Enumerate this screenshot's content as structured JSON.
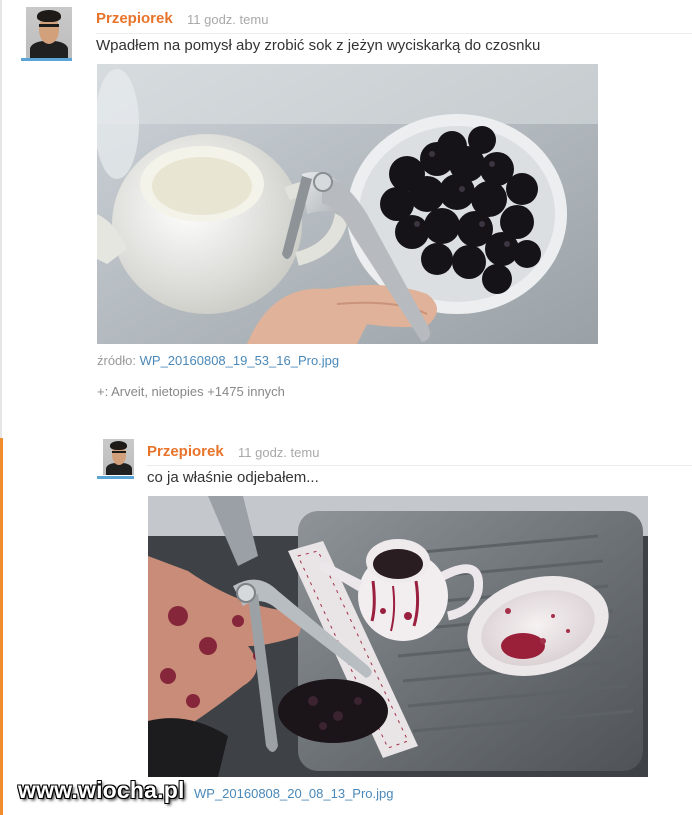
{
  "posts": [
    {
      "author": "Przepiorek",
      "time": "11 godz. temu",
      "text": "Wpadłem na pomysł aby zrobić sok z jeżyn wyciskarką do czosnku",
      "source_label": "źródło: ",
      "source_file": "WP_20160808_19_53_16_Pro.jpg",
      "plus_line": "+: Arveit, nietopies +1475 innych"
    },
    {
      "author": "Przepiorek",
      "time": "11 godz. temu",
      "text": "co ja właśnie odjebałem...",
      "source_file": "WP_20160808_20_08_13_Pro.jpg"
    }
  ],
  "watermark": "www.wiocha.pl",
  "colors": {
    "author": "#e8742b",
    "link": "#4a88b8",
    "accent_bar": "#f08b2e",
    "avatar_underline": "#5aa4d6"
  },
  "icons": {
    "avatar": "user-avatar-photo"
  }
}
